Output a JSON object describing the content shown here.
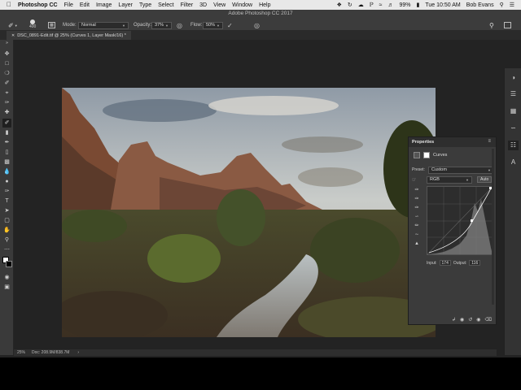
{
  "menubar": {
    "app_name": "Photoshop CC",
    "items": [
      "File",
      "Edit",
      "Image",
      "Layer",
      "Type",
      "Select",
      "Filter",
      "3D",
      "View",
      "Window",
      "Help"
    ],
    "battery": "99%",
    "clock": "Tue 10:50 AM",
    "user": "Bob Evans"
  },
  "options_bar": {
    "window_title": "Adobe Photoshop CC 2017",
    "brush_size": "400",
    "mode_label": "Mode:",
    "mode_value": "Normal",
    "opacity_label": "Opacity:",
    "opacity_value": "37%",
    "flow_label": "Flow:",
    "flow_value": "50%"
  },
  "document_tab": {
    "title": "DSC_0891-Edit.tif @ 25% (Curves 1, Layer Mask/16) *"
  },
  "status_bar": {
    "zoom": "25%",
    "doc_info": "Doc: 208.9M/838.7M"
  },
  "properties": {
    "title": "Properties",
    "adjustment": "Curves",
    "preset_label": "Preset:",
    "preset_value": "Custom",
    "channel_value": "RGB",
    "auto_label": "Auto",
    "input_label": "Input:",
    "input_value": "174",
    "output_label": "Output:",
    "output_value": "116"
  },
  "colors": {
    "panel_bg": "#3b3b3b",
    "app_bg": "#232323",
    "menubar_bg": "#e8e8e8"
  }
}
